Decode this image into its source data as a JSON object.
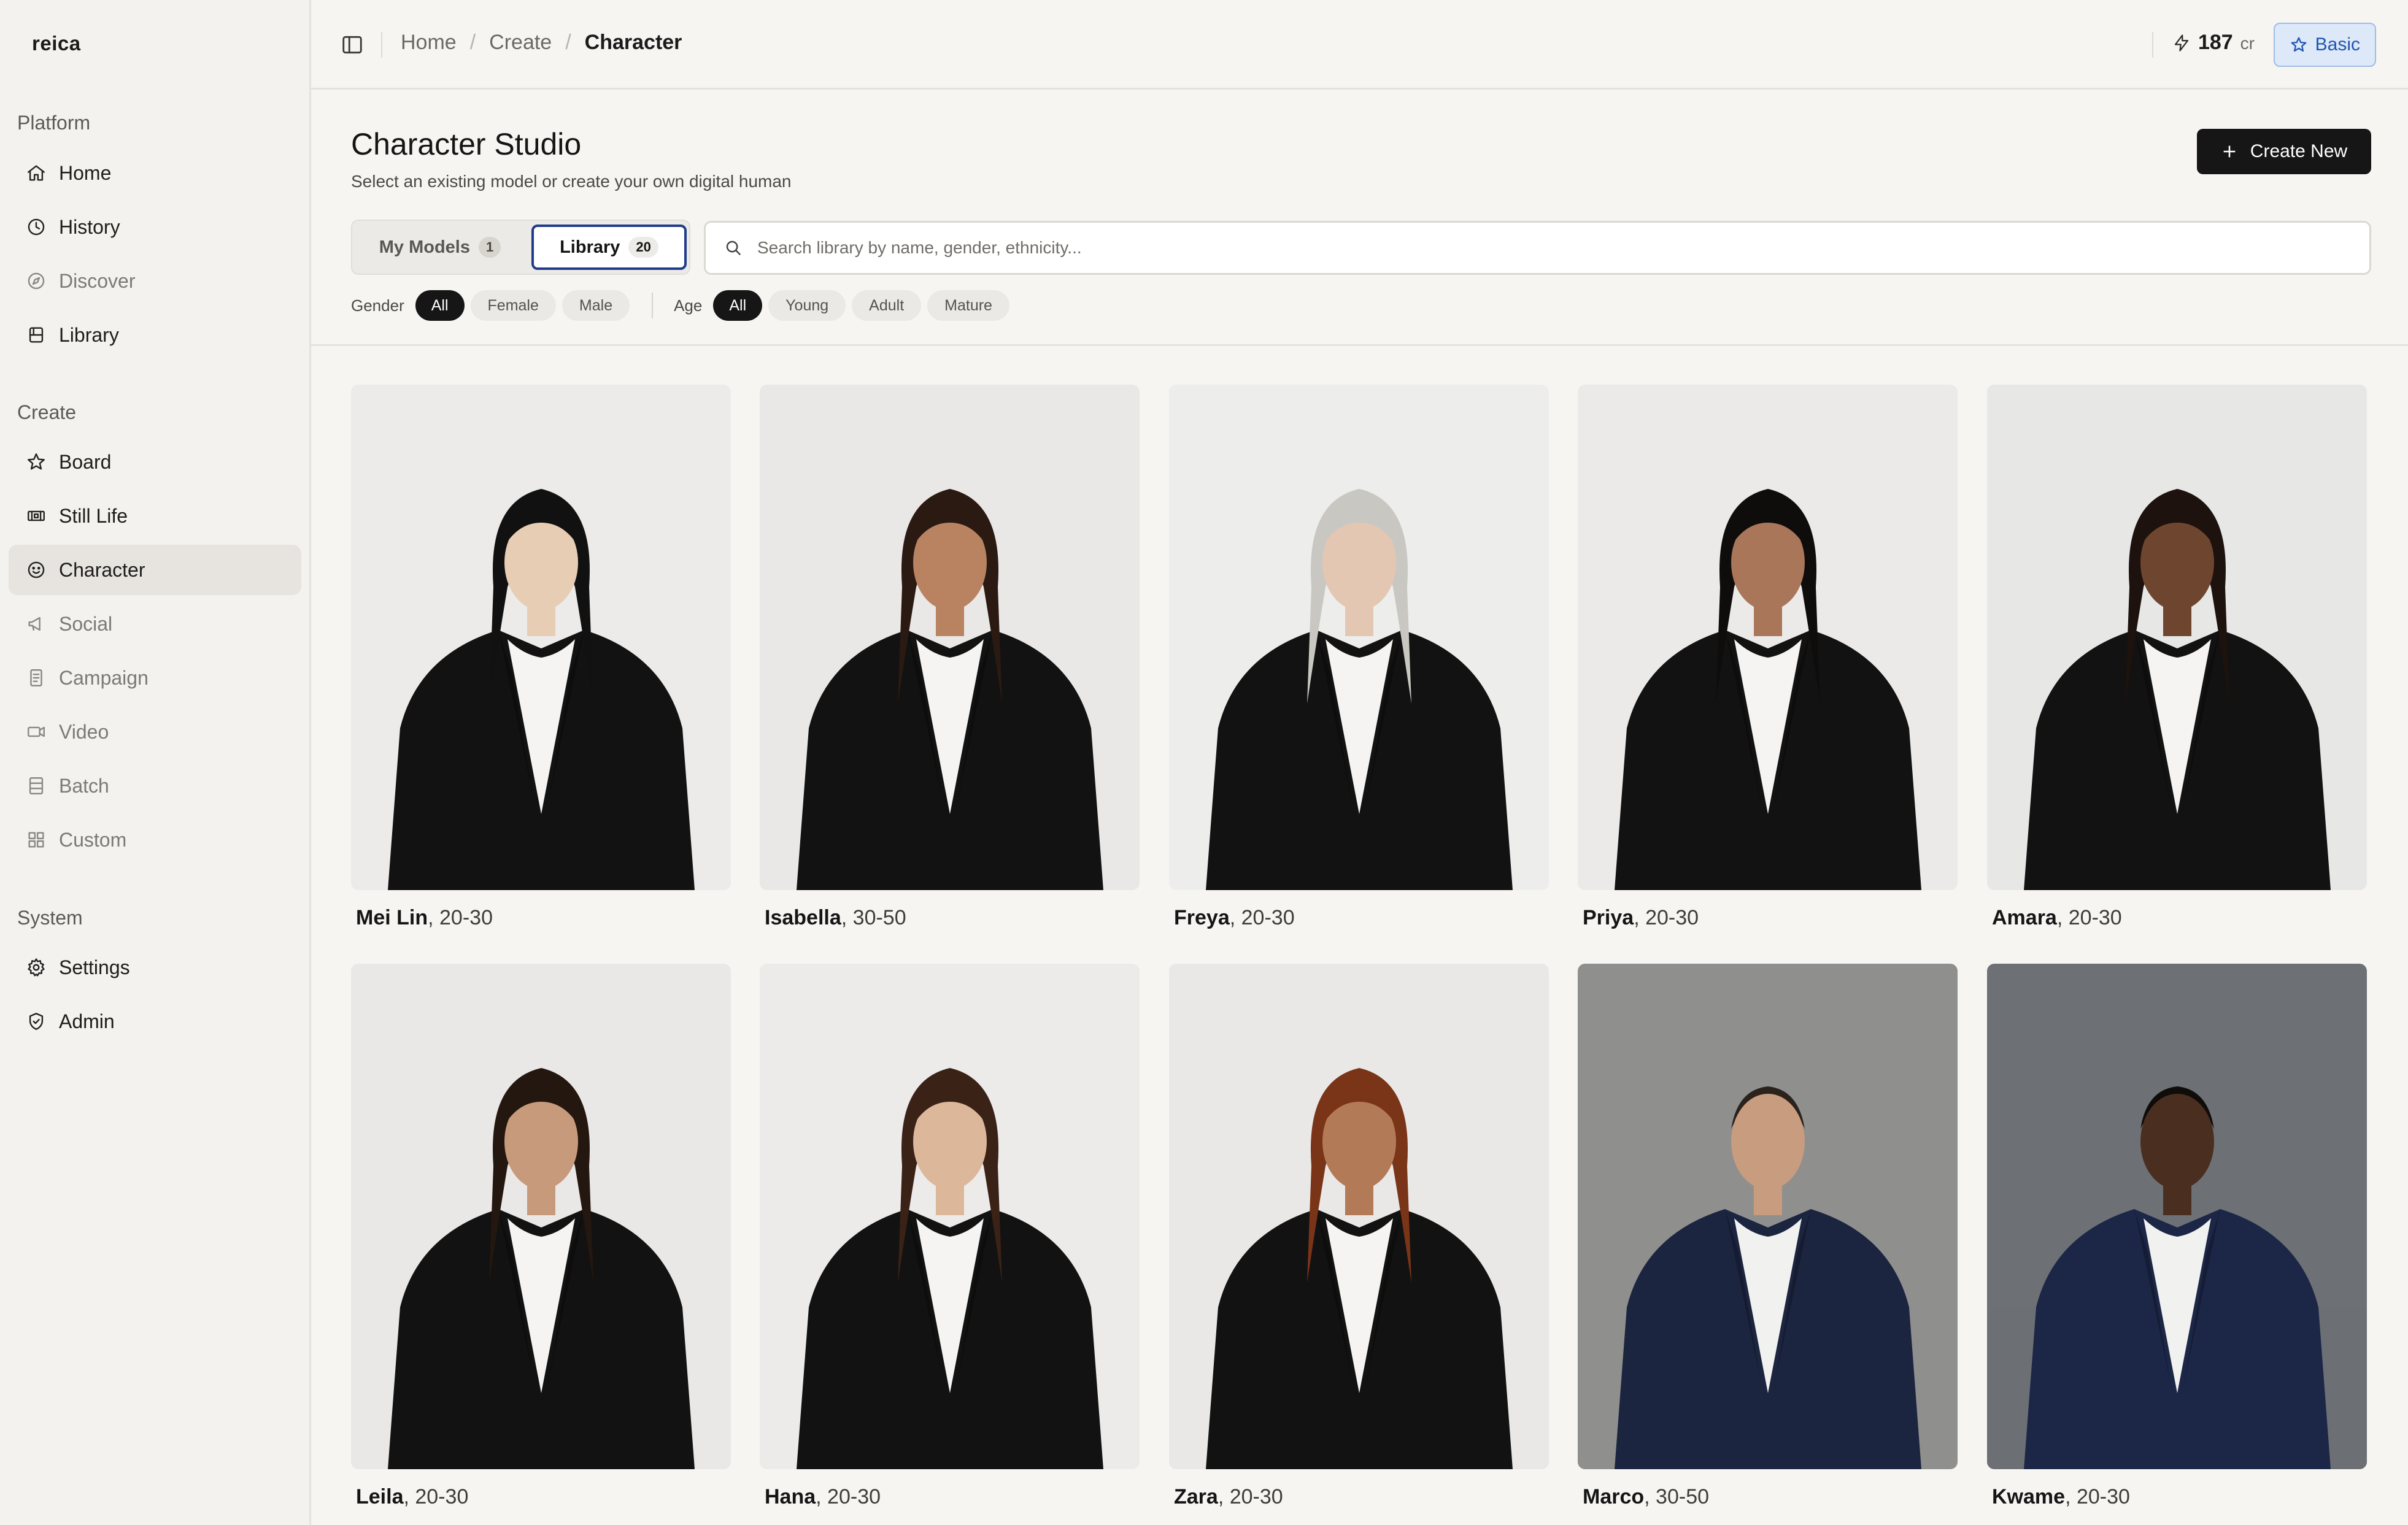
{
  "app": {
    "name": "reica"
  },
  "sidebar": {
    "sections": [
      {
        "title": "Platform",
        "items": [
          {
            "label": "Home",
            "icon": "home-icon",
            "state": "normal"
          },
          {
            "label": "History",
            "icon": "history-icon",
            "state": "normal"
          },
          {
            "label": "Discover",
            "icon": "compass-icon",
            "state": "dim"
          },
          {
            "label": "Library",
            "icon": "library-icon",
            "state": "normal"
          }
        ]
      },
      {
        "title": "Create",
        "items": [
          {
            "label": "Board",
            "icon": "star-icon",
            "state": "normal"
          },
          {
            "label": "Still Life",
            "icon": "image-strip-icon",
            "state": "normal"
          },
          {
            "label": "Character",
            "icon": "smile-icon",
            "state": "active"
          },
          {
            "label": "Social",
            "icon": "megaphone-icon",
            "state": "dim"
          },
          {
            "label": "Campaign",
            "icon": "document-icon",
            "state": "dim"
          },
          {
            "label": "Video",
            "icon": "video-icon",
            "state": "dim"
          },
          {
            "label": "Batch",
            "icon": "list-icon",
            "state": "dim"
          },
          {
            "label": "Custom",
            "icon": "grid-icon",
            "state": "dim"
          }
        ]
      },
      {
        "title": "System",
        "items": [
          {
            "label": "Settings",
            "icon": "gear-icon",
            "state": "normal"
          },
          {
            "label": "Admin",
            "icon": "shield-icon",
            "state": "normal"
          }
        ]
      }
    ]
  },
  "header": {
    "breadcrumbs": [
      "Home",
      "Create",
      "Character"
    ],
    "credits": {
      "value": "187",
      "unit": "cr"
    },
    "plan": "Basic"
  },
  "page": {
    "title": "Character Studio",
    "subtitle": "Select an existing model or create your own digital human",
    "create_label": "Create New"
  },
  "tabs": [
    {
      "label": "My Models",
      "count": "1",
      "active": false
    },
    {
      "label": "Library",
      "count": "20",
      "active": true
    }
  ],
  "search": {
    "placeholder": "Search library by name, gender, ethnicity..."
  },
  "filters": {
    "gender": {
      "label": "Gender",
      "options": [
        "All",
        "Female",
        "Male"
      ],
      "selected": "All"
    },
    "age": {
      "label": "Age",
      "options": [
        "All",
        "Young",
        "Adult",
        "Mature"
      ],
      "selected": "All"
    }
  },
  "characters": [
    {
      "name": "Mei Lin",
      "age": "20-30",
      "bg": "#ecebea",
      "skin": "#e7cdb4",
      "hair": "#111111",
      "suit": "#121212",
      "shirt": "#f5f4f2"
    },
    {
      "name": "Isabella",
      "age": "30-50",
      "bg": "#e9e8e6",
      "skin": "#b98362",
      "hair": "#2a1a12",
      "suit": "#121212",
      "shirt": "#f5f4f2"
    },
    {
      "name": "Freya",
      "age": "20-30",
      "bg": "#ededec",
      "skin": "#e3c7b3",
      "hair": "#c9c7c2",
      "suit": "#121212",
      "shirt": "#f5f4f2"
    },
    {
      "name": "Priya",
      "age": "20-30",
      "bg": "#ebeae8",
      "skin": "#a9765a",
      "hair": "#0f0d0c",
      "suit": "#121212",
      "shirt": "#f5f4f2"
    },
    {
      "name": "Amara",
      "age": "20-30",
      "bg": "#e7e7e6",
      "skin": "#6e4630",
      "hair": "#1d120d",
      "suit": "#121212",
      "shirt": "#f5f4f2"
    },
    {
      "name": "Leila",
      "age": "20-30",
      "bg": "#e9e8e7",
      "skin": "#c79a7b",
      "hair": "#24170f",
      "suit": "#121212",
      "shirt": "#f5f4f2"
    },
    {
      "name": "Hana",
      "age": "20-30",
      "bg": "#ecebea",
      "skin": "#dcb79a",
      "hair": "#3a2216",
      "suit": "#121212",
      "shirt": "#f5f4f2"
    },
    {
      "name": "Zara",
      "age": "20-30",
      "bg": "#e9e8e6",
      "skin": "#b27a56",
      "hair": "#7a3418",
      "suit": "#121212",
      "shirt": "#f5f4f2"
    },
    {
      "name": "Marco",
      "age": "30-50",
      "bg": "#8f8f8d",
      "skin": "#c89c7f",
      "hair": "#2b221c",
      "suit": "#1c2540",
      "shirt": "#f1f1ef"
    },
    {
      "name": "Kwame",
      "age": "20-30",
      "bg": "#6d7075",
      "skin": "#4a2f20",
      "hair": "#0f0c0a",
      "suit": "#1c2748",
      "shirt": "#f1f1ef"
    }
  ]
}
